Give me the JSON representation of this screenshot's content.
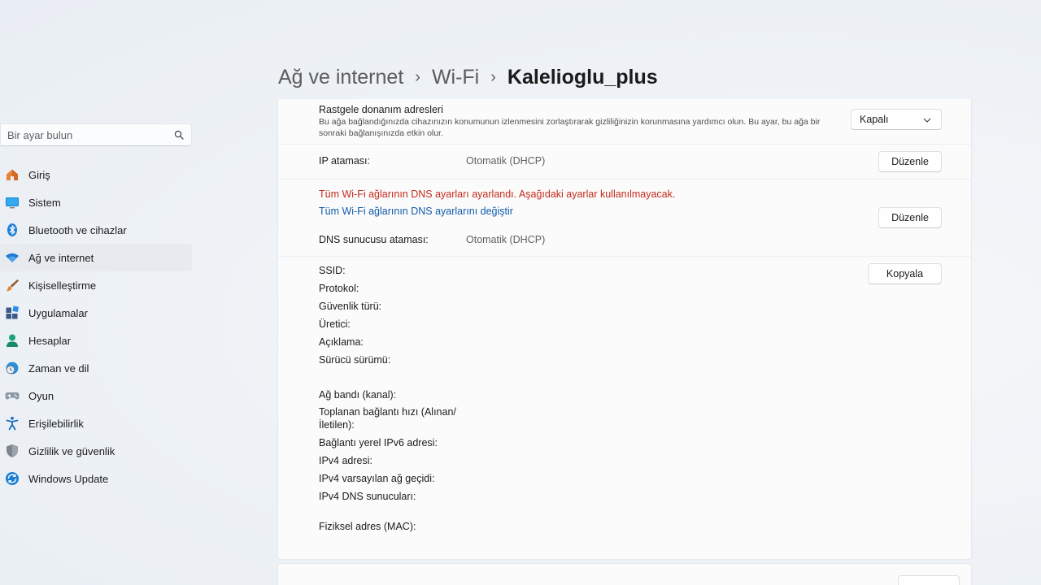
{
  "sidebar": {
    "search": {
      "placeholder": "Bir ayar bulun"
    },
    "items": [
      {
        "label": "Giriş",
        "icon": "home-icon"
      },
      {
        "label": "Sistem",
        "icon": "system-icon"
      },
      {
        "label": "Bluetooth ve cihazlar",
        "icon": "bluetooth-icon"
      },
      {
        "label": "Ağ ve internet",
        "icon": "wifi-icon",
        "selected": true
      },
      {
        "label": "Kişiselleştirme",
        "icon": "brush-icon"
      },
      {
        "label": "Uygulamalar",
        "icon": "apps-icon"
      },
      {
        "label": "Hesaplar",
        "icon": "person-icon"
      },
      {
        "label": "Zaman ve dil",
        "icon": "clock-globe-icon"
      },
      {
        "label": "Oyun",
        "icon": "gamepad-icon"
      },
      {
        "label": "Erişilebilirlik",
        "icon": "accessibility-icon"
      },
      {
        "label": "Gizlilik ve güvenlik",
        "icon": "shield-icon"
      },
      {
        "label": "Windows Update",
        "icon": "update-icon"
      }
    ]
  },
  "header": {
    "crumbs": [
      "Ağ ve internet",
      "Wi-Fi",
      "Kalelioglu_plus"
    ]
  },
  "random_hw": {
    "title": "Rastgele donanım adresleri",
    "description": "Bu ağa bağlandığınızda cihazınızın konumunun izlenmesini zorlaştırarak gizliliğinizin korunmasına yardımcı olun. Bu ayar, bu ağa bir sonraki bağlanışınızda etkin olur.",
    "dropdown_value": "Kapalı"
  },
  "ip": {
    "label": "IP ataması:",
    "value": "Otomatik (DHCP)",
    "button": "Düzenle"
  },
  "dns": {
    "warning": "Tüm Wi-Fi ağlarının DNS ayarları ayarlandı. Aşağıdaki ayarlar kullanılmayacak.",
    "link": "Tüm Wi-Fi ağlarının DNS ayarlarını değiştir",
    "label": "DNS sunucusu ataması:",
    "value": "Otomatik (DHCP)",
    "button": "Düzenle"
  },
  "properties": {
    "copy_button": "Kopyala",
    "ssid": "SSID:",
    "protocol": "Protokol:",
    "security": "Güvenlik türü:",
    "manufacturer": "Üretici:",
    "description": "Açıklama:",
    "driver": "Sürücü sürümü:",
    "band": "Ağ bandı (kanal):",
    "speed_line1": "Toplanan bağlantı hızı (Alınan/",
    "speed_line2": "İletilen):",
    "ipv6": "Bağlantı yerel IPv6 adresi:",
    "ipv4": "IPv4 adresi:",
    "gateway": "IPv4 varsayılan ağ geçidi:",
    "ipv4dns": "IPv4 DNS sunucuları:",
    "mac": "Fiziksel adres (MAC):"
  },
  "colors": {
    "accent": "#0067c0",
    "warning": "#c42b1c",
    "link": "#0f5aa8"
  }
}
